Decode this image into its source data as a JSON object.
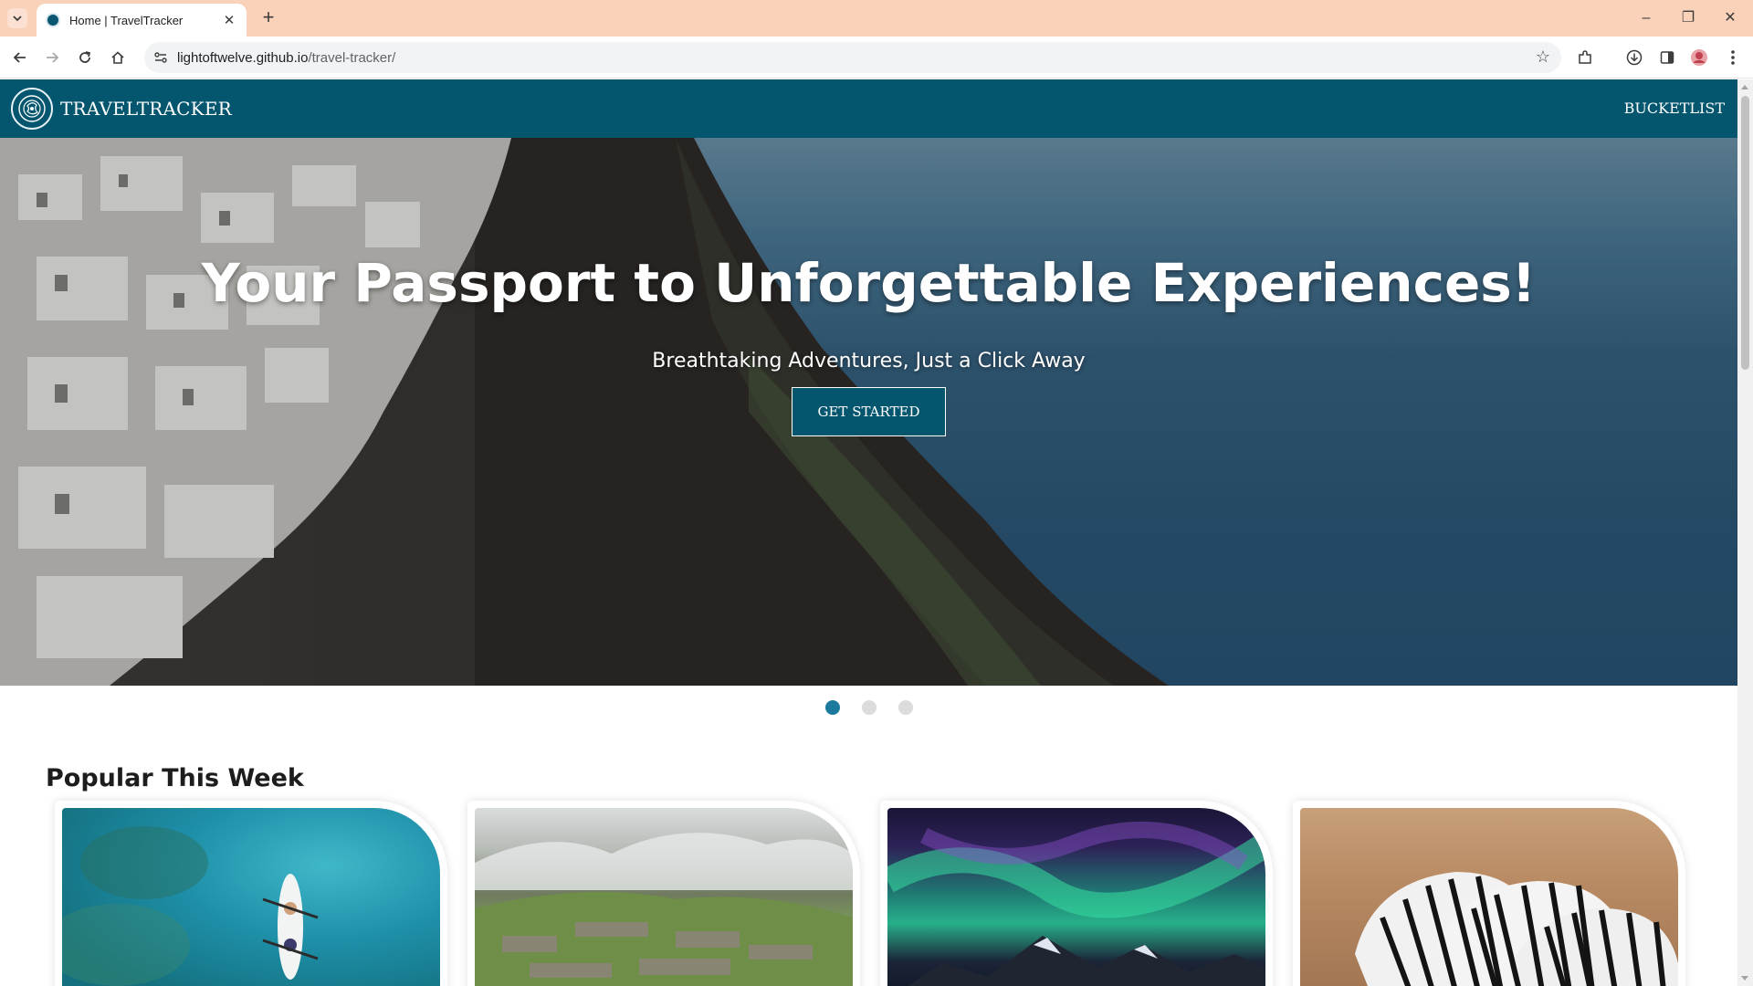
{
  "browser": {
    "tab_title": "Home | TravelTracker",
    "url_host": "lightoftwelve.github.io",
    "url_path": "/travel-tracker/"
  },
  "navbar": {
    "brand": "TRAVELTRACKER",
    "links": [
      "BUCKETLIST"
    ]
  },
  "hero": {
    "title": "Your Passport to Unforgettable Experiences!",
    "subtitle": "Breathtaking Adventures, Just a Click Away",
    "cta_label": "GET STARTED",
    "slide_count": 3,
    "active_slide": 1
  },
  "popular": {
    "title": "Popular This Week",
    "cards": [
      {
        "image": "kayak-lagoon"
      },
      {
        "image": "mountain-ruins"
      },
      {
        "image": "northern-lights"
      },
      {
        "image": "zebra-herd"
      }
    ]
  },
  "colors": {
    "brand": "#04566f",
    "dot_active": "#1b7a9e",
    "tabbar": "#fad2ba"
  }
}
